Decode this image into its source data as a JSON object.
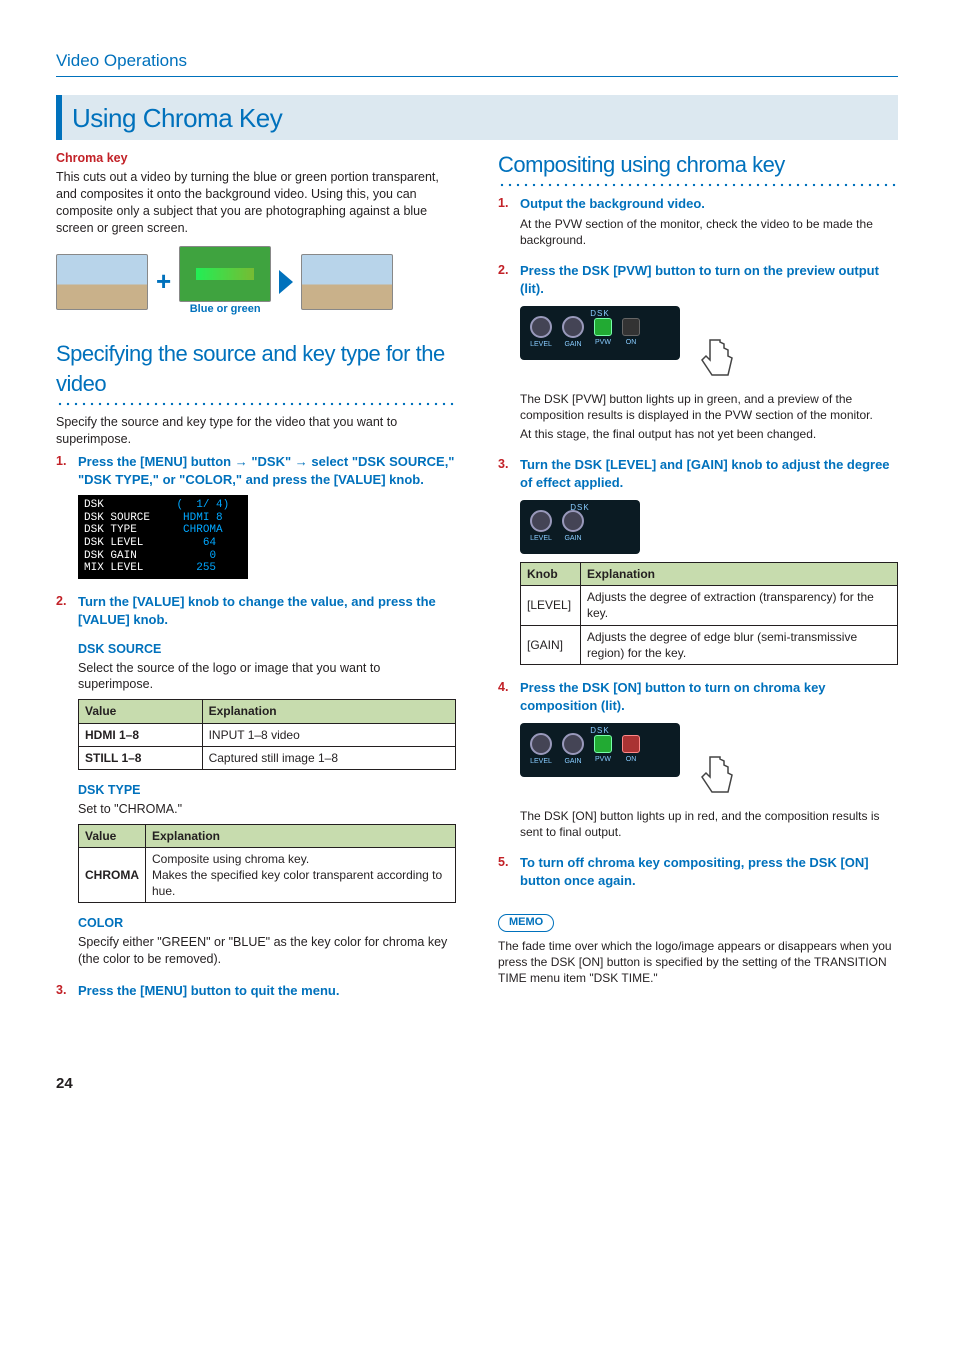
{
  "breadcrumb": "Video Operations",
  "h1": "Using Chroma Key",
  "left": {
    "chromakey_label": "Chroma key",
    "chromakey_desc": "This cuts out a video by turning the blue or green portion transparent, and composites it onto the background video. Using this, you can composite only a subject that you are photographing against a blue screen or green screen.",
    "plus": "+",
    "blue_or_green": "Blue or green",
    "h2a": "Specifying the source and key type for the video",
    "h2a_desc": "Specify the source and key type for the video that you want to superimpose.",
    "step1_title_a": "Press the [MENU] button ",
    "arrow": "→",
    "step1_title_b": " \"DSK\" ",
    "step1_title_c": " select \"DSK SOURCE,\" \"DSK TYPE,\" or \"COLOR,\" and press the [VALUE] knob.",
    "lcd": {
      "l1w": "DSK",
      "l1r": "(  1/ 4)",
      "l2a": "DSK SOURCE",
      "l2b": "HDMI 8",
      "l3a": "DSK TYPE",
      "l3b": "CHROMA",
      "l4a": "DSK LEVEL",
      "l4b": "64",
      "l5a": "DSK GAIN",
      "l5b": "0",
      "l6a": "MIX LEVEL",
      "l6b": "255"
    },
    "step2_title": "Turn the [VALUE] knob to change the value, and press the [VALUE] knob.",
    "dsk_source_h": "DSK SOURCE",
    "dsk_source_desc": "Select the source of the logo or image that you want to superimpose.",
    "tbl1_h1": "Value",
    "tbl1_h2": "Explanation",
    "tbl1_r1c1": "HDMI 1–8",
    "tbl1_r1c2": "INPUT 1–8 video",
    "tbl1_r2c1": "STILL 1–8",
    "tbl1_r2c2": "Captured still image 1–8",
    "dsk_type_h": "DSK TYPE",
    "dsk_type_desc": "Set to \"CHROMA.\"",
    "tbl2_h1": "Value",
    "tbl2_h2": "Explanation",
    "tbl2_r1c1": "CHROMA",
    "tbl2_r1c2a": "Composite using chroma key.",
    "tbl2_r1c2b": "Makes the specified key color transparent according to hue.",
    "color_h": "COLOR",
    "color_desc": "Specify either \"GREEN\" or \"BLUE\" as the key color for chroma key (the color to be removed).",
    "step3_title": "Press the [MENU] button to quit the menu."
  },
  "right": {
    "h2b": "Compositing using chroma key",
    "s1_title": "Output the background video.",
    "s1_body": "At the PVW section of the monitor, check the video to be made the background.",
    "s2_title": "Press the DSK [PVW] button to turn on the preview output (lit).",
    "s2_body_a": "The DSK [PVW] button lights up in green, and a preview of the composition results is displayed in the PVW section of the monitor.",
    "s2_body_b": "At this stage, the final output has not yet been changed.",
    "panel_label": "DSK",
    "knob_level": "LEVEL",
    "knob_gain": "GAIN",
    "btn_pvw": "PVW",
    "btn_on": "ON",
    "s3_title": "Turn the DSK [LEVEL] and [GAIN] knob to adjust the degree of effect applied.",
    "tbl3_h1": "Knob",
    "tbl3_h2": "Explanation",
    "tbl3_r1c1": "[LEVEL]",
    "tbl3_r1c2": "Adjusts the degree of extraction (transparency) for the key.",
    "tbl3_r2c1": "[GAIN]",
    "tbl3_r2c2": "Adjusts the degree of edge blur (semi-transmissive region) for the key.",
    "s4_title": "Press the DSK [ON] button to turn on chroma key composition (lit).",
    "s4_body": "The DSK [ON] button lights up in red, and the composition results is sent to final output.",
    "s5_title": "To turn off chroma key compositing, press the DSK [ON] button once again.",
    "memo_label": "MEMO",
    "memo_body": "The fade time over which the logo/image appears or disappears when you press the DSK [ON] button is specified by the setting of the TRANSITION TIME menu item \"DSK TIME.\""
  },
  "pagenum": "24"
}
